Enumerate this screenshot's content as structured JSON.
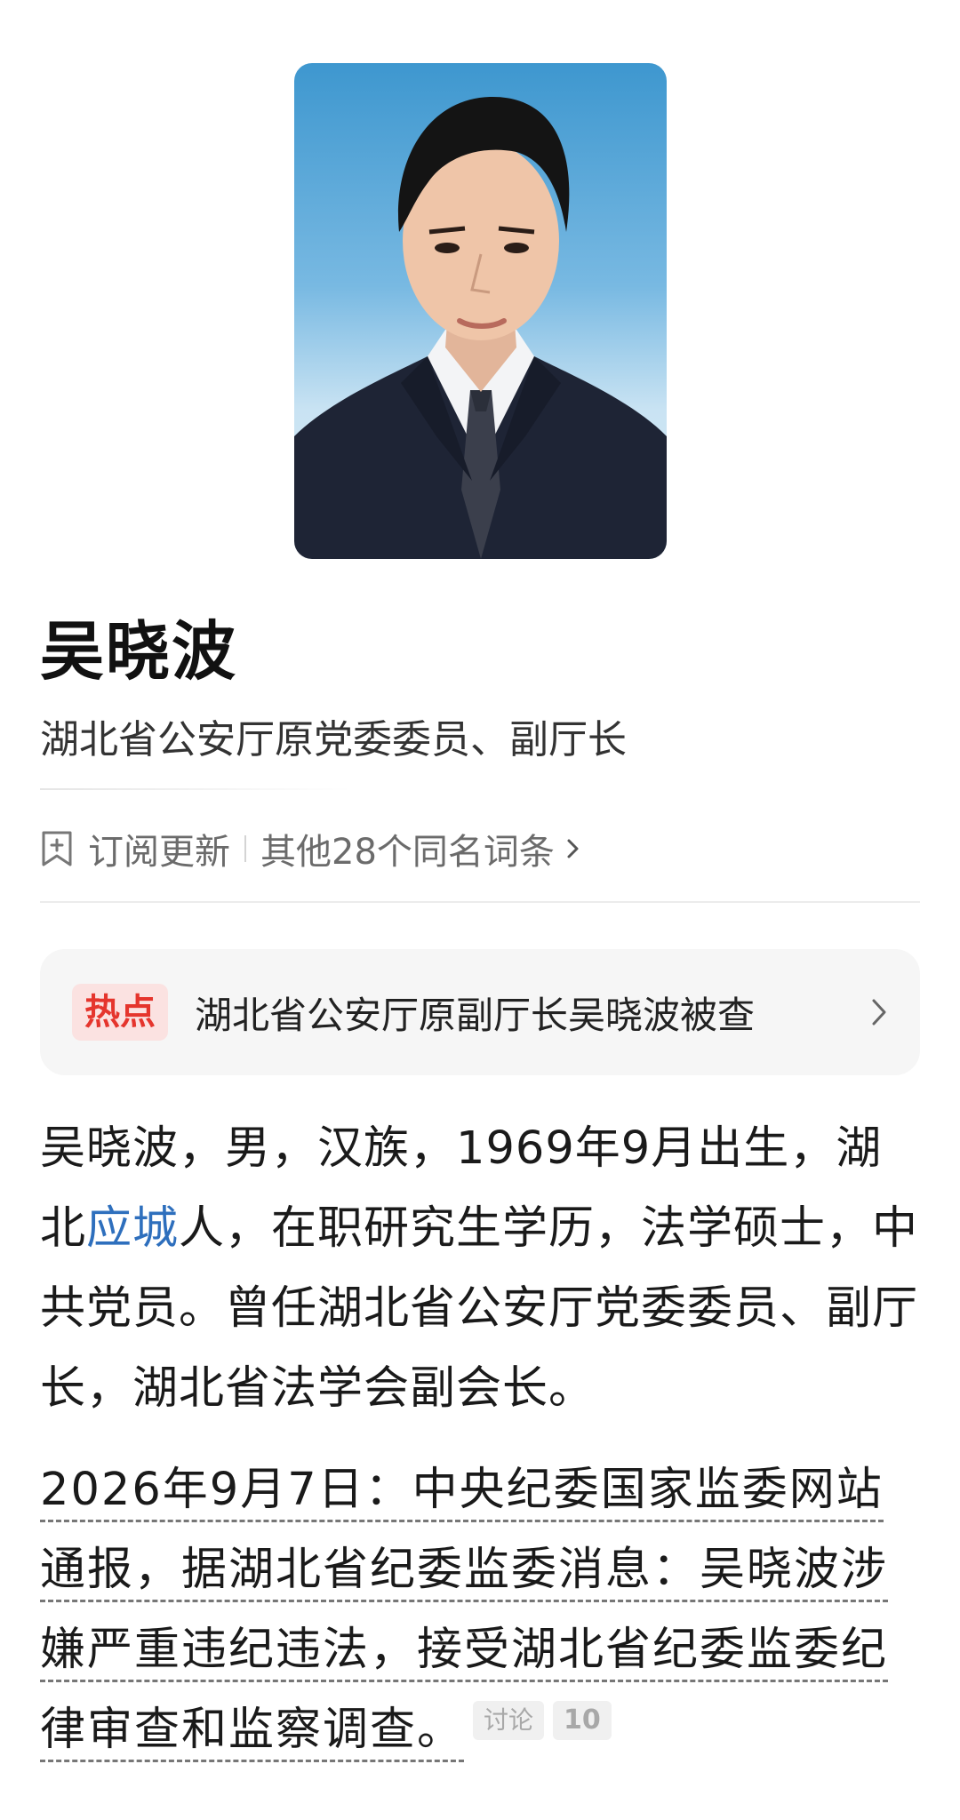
{
  "profile": {
    "name": "吴晓波",
    "subtitle": "湖北省公安厅原党委委员、副厅长"
  },
  "actions": {
    "subscribe_label": "订阅更新",
    "same_name_label": "其他28个同名词条"
  },
  "hot": {
    "badge": "热点",
    "headline": "湖北省公安厅原副厅长吴晓波被查"
  },
  "summary": {
    "part1": "吴晓波，男，汉族，1969年9月出生，湖北",
    "link": "应城",
    "part2": "人，在职研究生学历，法学硕士，中共党员。曾任湖北省公安厅党委委员、副厅长，湖北省法学会副会长。"
  },
  "news": {
    "text": "2026年9月7日：中央纪委国家监委网站通报，据湖北省纪委监委消息：吴晓波涉嫌严重违纪违法，接受湖北省纪委监委纪律审查和监察调查。",
    "discuss_label": "讨论",
    "discuss_count": "10"
  },
  "colors": {
    "link": "#2e6fbd",
    "hot_badge_text": "#e5352d",
    "hot_badge_bg": "#fbe2e1",
    "card_bg": "#f6f6f6"
  },
  "icons": {
    "subscribe": "bookmark-plus-icon",
    "same_name": "chevron-right-icon",
    "hot": "chevron-right-icon"
  }
}
